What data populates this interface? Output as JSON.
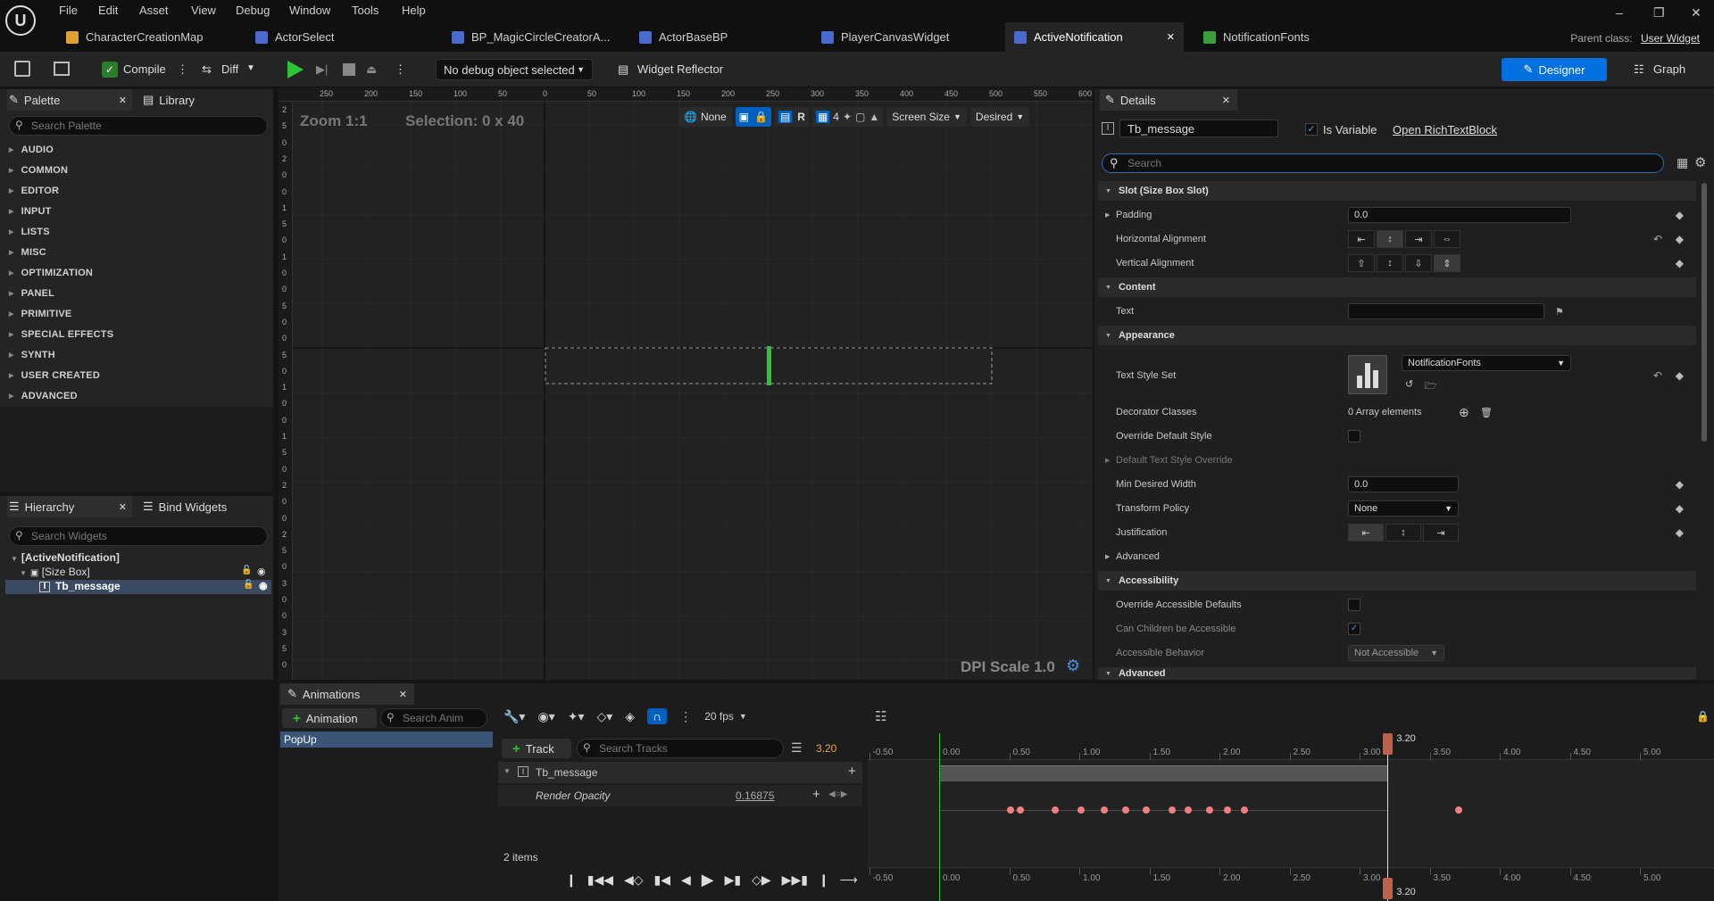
{
  "menu": [
    "File",
    "Edit",
    "Asset",
    "View",
    "Debug",
    "Window",
    "Tools",
    "Help"
  ],
  "tabs": [
    {
      "label": "CharacterCreationMap",
      "active": false
    },
    {
      "label": "ActorSelect",
      "active": false
    },
    {
      "label": "BP_MagicCircleCreatorA...",
      "active": false
    },
    {
      "label": "ActorBaseBP",
      "active": false
    },
    {
      "label": "PlayerCanvasWidget",
      "active": false
    },
    {
      "label": "ActiveNotification",
      "active": true
    },
    {
      "label": "NotificationFonts",
      "active": false
    }
  ],
  "parent_class": {
    "label": "Parent class:",
    "value": "User Widget"
  },
  "toolbar": {
    "compile": "Compile",
    "diff": "Diff",
    "debug_object": "No debug object selected",
    "widget_reflector": "Widget Reflector",
    "designer": "Designer",
    "graph": "Graph"
  },
  "palette": {
    "tab": "Palette",
    "library_tab": "Library",
    "search_placeholder": "Search Palette",
    "categories": [
      "AUDIO",
      "COMMON",
      "EDITOR",
      "INPUT",
      "LISTS",
      "MISC",
      "OPTIMIZATION",
      "PANEL",
      "PRIMITIVE",
      "SPECIAL EFFECTS",
      "SYNTH",
      "USER CREATED",
      "ADVANCED"
    ]
  },
  "hierarchy": {
    "tab": "Hierarchy",
    "bind_tab": "Bind Widgets",
    "search_placeholder": "Search Widgets",
    "root": "[ActiveNotification]",
    "size_box": "[Size Box]",
    "tb_message": "Tb_message"
  },
  "viewport": {
    "zoom": "Zoom 1:1",
    "selection": "Selection: 0 x 40",
    "none": "None",
    "r": "R",
    "grid": "4",
    "screen_size": "Screen Size",
    "desired": "Desired",
    "dpi": "DPI Scale 1.0",
    "ruler_h": [
      "250",
      "200",
      "150",
      "100",
      "50",
      "0",
      "50",
      "100",
      "150",
      "200",
      "250",
      "300",
      "350",
      "400",
      "450",
      "500",
      "550",
      "600"
    ],
    "ruler_v": [
      "2",
      "5",
      "0",
      "2",
      "0",
      "0",
      "1",
      "5",
      "0",
      "1",
      "0",
      "0",
      "5",
      "0",
      "0",
      "5",
      "0",
      "1",
      "0",
      "0",
      "1",
      "5",
      "0",
      "2",
      "0",
      "0",
      "2",
      "5",
      "0",
      "3",
      "0",
      "0",
      "3",
      "5",
      "0"
    ]
  },
  "details": {
    "tab": "Details",
    "name": "Tb_message",
    "is_variable": "Is Variable",
    "open_link": "Open RichTextBlock",
    "search_placeholder": "Search",
    "sec_slot": "Slot (Size Box Slot)",
    "padding": "Padding",
    "padding_val": "0.0",
    "h_align": "Horizontal Alignment",
    "v_align": "Vertical Alignment",
    "sec_content": "Content",
    "text": "Text",
    "sec_appearance": "Appearance",
    "text_style_set": "Text Style Set",
    "text_style_val": "NotificationFonts",
    "decorator": "Decorator Classes",
    "decorator_val": "0 Array elements",
    "override_default": "Override Default Style",
    "default_override": "Default Text Style Override",
    "min_width": "Min Desired Width",
    "min_width_val": "0.0",
    "transform": "Transform Policy",
    "transform_val": "None",
    "justification": "Justification",
    "advanced": "Advanced",
    "sec_accessibility": "Accessibility",
    "override_acc": "Override Accessible Defaults",
    "can_children": "Can Children be Accessible",
    "acc_behavior": "Accessible Behavior",
    "acc_behavior_val": "Not Accessible",
    "advanced2": "Advanced"
  },
  "animations": {
    "tab": "Animations",
    "add": "Animation",
    "search_placeholder": "Search Anim",
    "list": [
      "PopUp"
    ],
    "fps": "20 fps",
    "add_track": "Track",
    "search_tracks": "Search Tracks",
    "time": "3.20",
    "track_name": "Tb_message",
    "property": "Render Opacity",
    "property_val": "0.16875",
    "count": "2 items",
    "playhead": "3.20",
    "timeline_labels": [
      "-0.50",
      "0.00",
      "0.50",
      "1.00",
      "1.50",
      "2.00",
      "2.50",
      "3.00",
      "3.50",
      "4.00",
      "4.50",
      "5.00"
    ],
    "keyframes": [
      0.0,
      0.07,
      0.32,
      0.5,
      0.67,
      0.82,
      0.97,
      1.15,
      1.27,
      1.42,
      1.55,
      1.67,
      3.2
    ]
  },
  "colors": {
    "accent": "#0070e0",
    "green": "#2ec43a",
    "keyframe": "#f08080",
    "playhead": "#c0604a"
  }
}
